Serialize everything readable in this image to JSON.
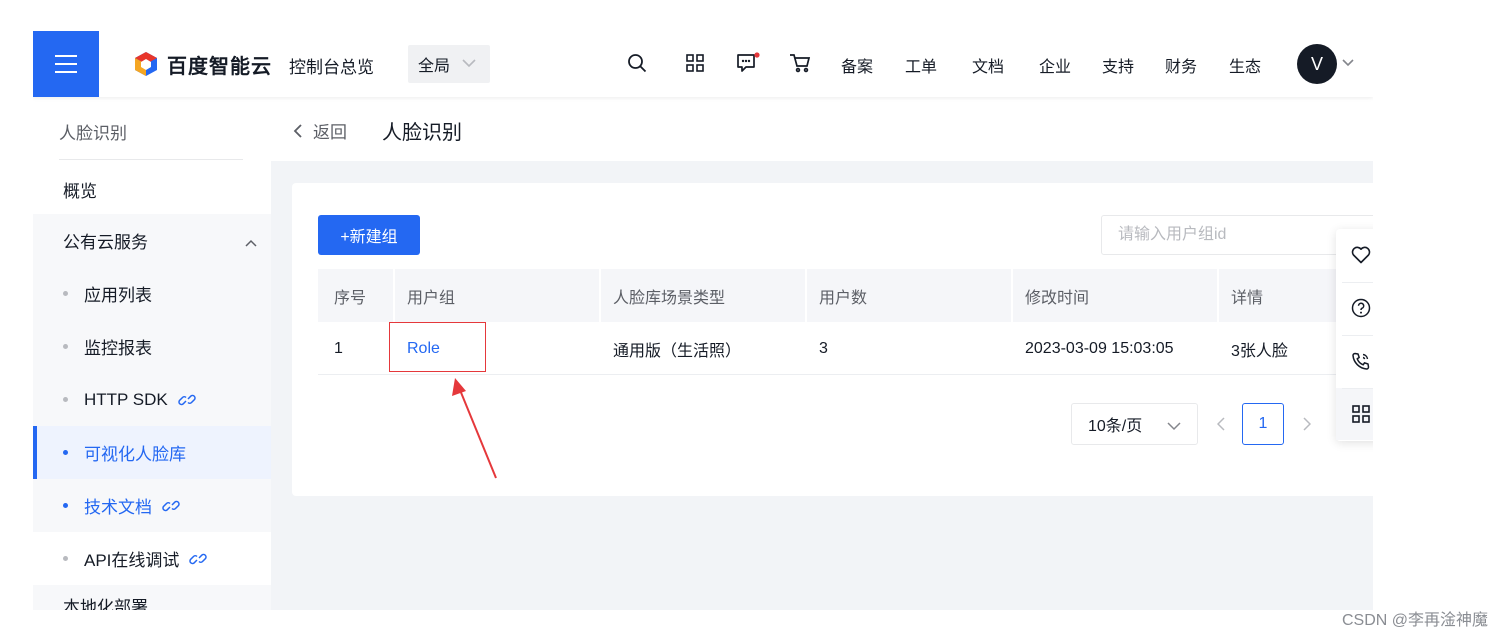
{
  "topbar": {
    "brand": "百度智能云",
    "console_overview": "控制台总览",
    "region": "全局",
    "nav": [
      "备案",
      "工单",
      "文档",
      "企业",
      "支持",
      "财务",
      "生态"
    ],
    "avatar_letter": "V",
    "accent_color": "#2468f2"
  },
  "sidebar": {
    "title": "人脸识别",
    "overview": "概览",
    "group_label": "公有云服务",
    "items": [
      {
        "label": "应用列表"
      },
      {
        "label": "监控报表"
      },
      {
        "label": "HTTP SDK",
        "icon": "link-icon"
      },
      {
        "label": "可视化人脸库",
        "active": true
      },
      {
        "label": "技术文档",
        "icon": "link-icon"
      },
      {
        "label": "API在线调试",
        "icon": "link-icon"
      }
    ],
    "local_label": "本地化部署"
  },
  "header": {
    "back": "返回",
    "title": "人脸识别"
  },
  "toolbar": {
    "new_group": "+新建组",
    "search_placeholder": "请输入用户组id"
  },
  "table": {
    "columns": [
      "序号",
      "用户组",
      "人脸库场景类型",
      "用户数",
      "修改时间",
      "详情"
    ],
    "rows": [
      [
        "1",
        "Role",
        "通用版（生活照）",
        "3",
        "2023-03-09 15:03:05",
        "3张人脸"
      ]
    ]
  },
  "pagination": {
    "page_size": "10条/页",
    "current_page": "1"
  },
  "float_tools": [
    "heart-icon",
    "help-icon",
    "phone-icon",
    "grid-icon"
  ],
  "watermark": "CSDN @李再淦神魔",
  "annotation_color": "#e5383b"
}
